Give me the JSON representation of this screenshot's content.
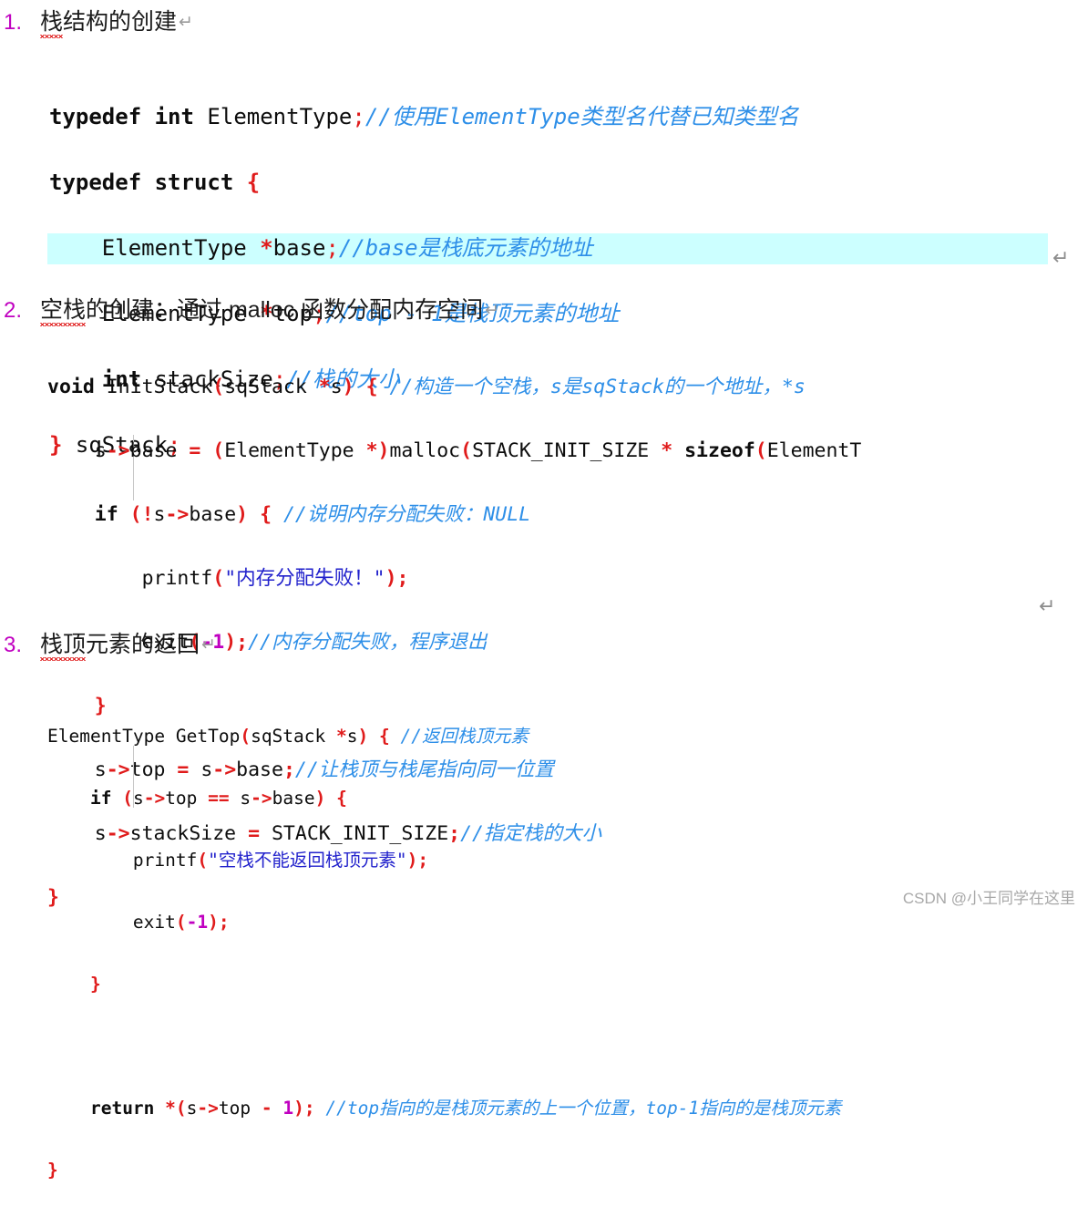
{
  "document": {
    "watermark": "CSDN @小王同学在这里",
    "return_mark": "↵",
    "highlight_color": "#ccffff",
    "colors": {
      "keyword": "#0d0d0d",
      "punctuation": "#e01b1b",
      "comment": "#2e8fe8",
      "string": "#2222cc",
      "number": "#c000c0",
      "heading": "#1a1a1a",
      "spellcheck_underline": "#e02020",
      "watermark": "#a8a8a8"
    }
  },
  "sections": [
    {
      "number": "1.",
      "title_spell_error": "栈",
      "title_rest": "结构的创建",
      "paragraph_mark": "↵"
    },
    {
      "number": "2.",
      "title_spell_error": "空栈",
      "title_rest": "的创建：通过 malloc 函数分配内存空间",
      "paragraph_mark": "↵"
    },
    {
      "number": "3.",
      "title_spell_error": "栈顶",
      "title_rest": "元素的返回",
      "paragraph_mark": "↵"
    }
  ],
  "code_block_1": {
    "lines": [
      "typedef int ElementType;//使用ElementType类型名代替已知类型名",
      "typedef struct {",
      "    ElementType *base;//base是栈底元素的地址",
      "    ElementType *top;//top - 1是栈顶元素的地址",
      "    int stackSize;//栈的大小",
      "} sqStack;"
    ],
    "highlighted_line_index": 5,
    "tokens": {
      "l1": {
        "kw1": "typedef",
        "kw2": "int",
        "id": " ElementType",
        "semi": ";",
        "comment": "//使用ElementType类型名代替已知类型名"
      },
      "l2": {
        "kw1": "typedef",
        "kw2": "struct",
        "brace": "{"
      },
      "l3": {
        "type": "ElementType ",
        "star": "*",
        "id": "base",
        "semi": ";",
        "comment": "//base是栈底元素的地址"
      },
      "l4": {
        "type": "ElementType ",
        "star": "*",
        "id": "top",
        "semi": ";",
        "comment": "//top - 1是栈顶元素的地址"
      },
      "l5": {
        "kw": "int",
        "id": " stackSize",
        "semi": ";",
        "comment": "//栈的大小"
      },
      "l6": {
        "brace": "}",
        "id": " sqStack",
        "semi": ";"
      }
    }
  },
  "code_block_2": {
    "lines": [
      "void InitStack(sqStack *s) { //构造一个空栈，s是sqStack的一个地址，*s",
      "    s->base = (ElementType *)malloc(STACK_INIT_SIZE * sizeof(ElementT",
      "    if (!s->base) { //说明内存分配失败：NULL",
      "        printf(\"内存分配失败！\");",
      "        exit(-1);//内存分配失败，程序退出",
      "    }",
      "    s->top = s->base;//让栈顶与栈尾指向同一位置",
      "    s->stackSize = STACK_INIT_SIZE;//指定栈的大小",
      "}"
    ],
    "truncated_right": true
  },
  "code_block_3": {
    "lines": [
      "ElementType GetTop(sqStack *s) { //返回栈顶元素",
      "    if (s->top == s->base) {",
      "        printf(\"空栈不能返回栈顶元素\");",
      "        exit(-1);",
      "    }",
      "",
      "    return *(s->top - 1); //top指向的是栈顶元素的上一个位置，top-1指向的是栈顶元素",
      "}"
    ]
  }
}
